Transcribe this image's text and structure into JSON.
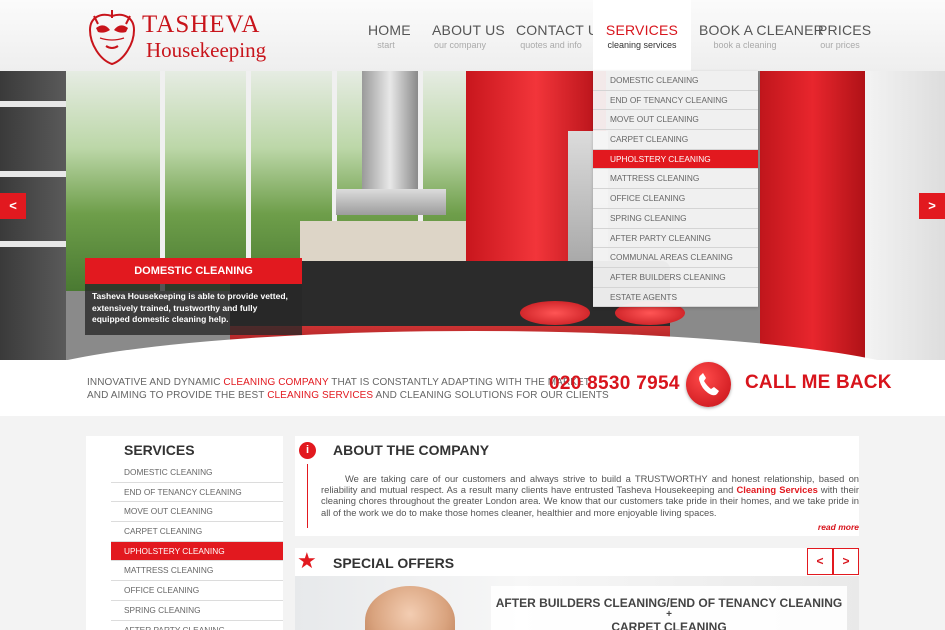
{
  "logo": {
    "brand": "TASHEVA",
    "sub": "Housekeeping"
  },
  "nav": [
    {
      "title": "HOME",
      "sub": "start"
    },
    {
      "title": "ABOUT US",
      "sub": "our company"
    },
    {
      "title": "CONTACT US",
      "sub": "quotes and info"
    },
    {
      "title": "SERVICES",
      "sub": "cleaning services"
    },
    {
      "title": "BOOK A CLEANER",
      "sub": "book a cleaning"
    },
    {
      "title": "PRICES",
      "sub": "our prices"
    }
  ],
  "dropdown": [
    "DOMESTIC CLEANING",
    "END OF TENANCY CLEANING",
    "MOVE OUT CLEANING",
    "CARPET CLEANING",
    "UPHOLSTERY CLEANING",
    "MATTRESS CLEANING",
    "OFFICE CLEANING",
    "SPRING CLEANING",
    "AFTER PARTY CLEANING",
    "COMMUNAL AREAS CLEANING",
    "AFTER BUILDERS CLEANING",
    "ESTATE AGENTS"
  ],
  "hero": {
    "prev": "<",
    "next": ">",
    "caption_title": "DOMESTIC CLEANING",
    "caption_text": "Tasheva Housekeeping is able to provide vetted, extensively trained, trustworthy and fully equipped domestic cleaning help."
  },
  "tagline": {
    "p1": "INNOVATIVE AND DYNAMIC ",
    "hl1": "CLEANING COMPANY",
    "p2": " THAT IS CONSTANTLY ADAPTING WITH THE MARKET",
    "p3": "AND AIMING TO PROVIDE THE BEST ",
    "hl2": "CLEANING SERVICES",
    "p4": " AND CLEANING SOLUTIONS FOR OUR CLIENTS"
  },
  "contact": {
    "phone": "020 8530 7954",
    "callback": "CALL ME BACK"
  },
  "sidebar": {
    "title": "SERVICES",
    "items": [
      "DOMESTIC CLEANING",
      "END OF TENANCY CLEANING",
      "MOVE OUT CLEANING",
      "CARPET CLEANING",
      "UPHOLSTERY CLEANING",
      "MATTRESS CLEANING",
      "OFFICE CLEANING",
      "SPRING CLEANING",
      "AFTER PARTY CLEANING"
    ]
  },
  "about": {
    "title": "ABOUT THE COMPANY",
    "text1": "We are taking care of our customers and always strive to build a TRUSTWORTHY and honest relationship, based on reliability and mutual respect. As a result many clients have entrusted Tasheva Housekeeping and ",
    "hl": "Cleaning Services",
    "text2": " with their cleaning chores throughout the greater London area. We know that our customers take pride in their homes, and we take pride in all of the work we do to make those homes cleaner, healthier and more enjoyable living spaces.",
    "read_more": "read more"
  },
  "offers": {
    "title": "SPECIAL OFFERS",
    "prev": "<",
    "next": ">",
    "line1": "AFTER BUILDERS CLEANING/END OF TENANCY CLEANING",
    "plus": "+",
    "line2": "CARPET  CLEANING"
  },
  "colors": {
    "accent": "#e2191f",
    "text": "#555555"
  }
}
